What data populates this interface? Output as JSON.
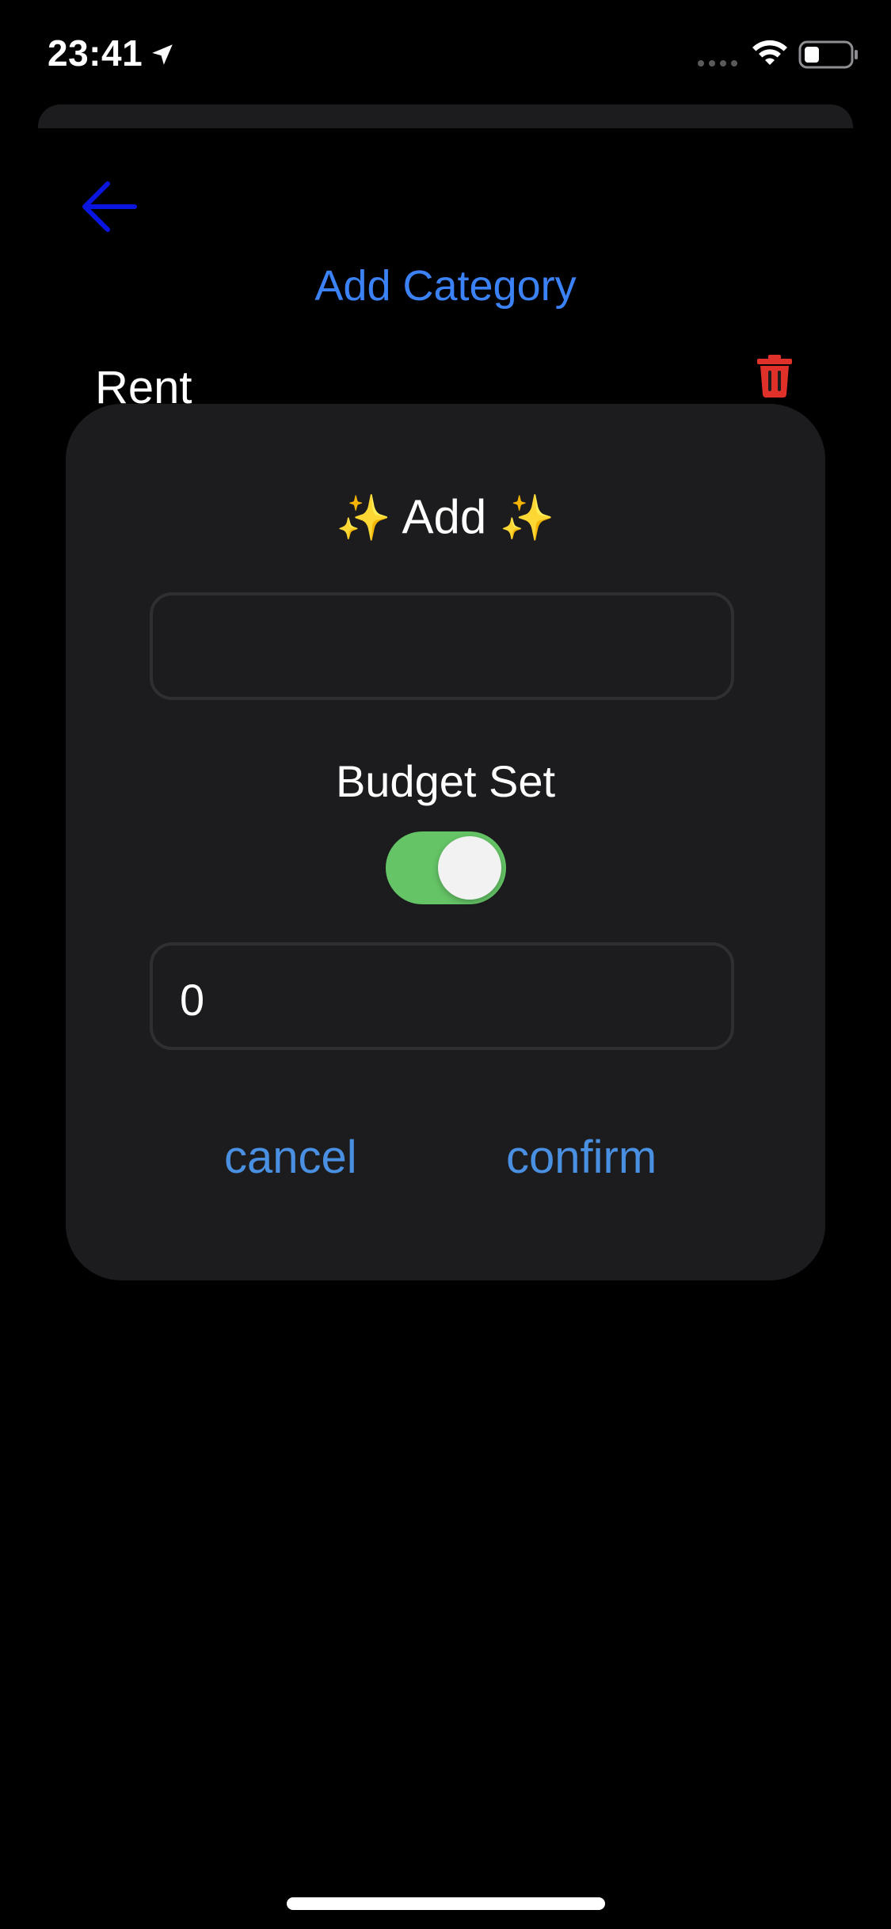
{
  "status_bar": {
    "time": "23:41",
    "location_icon": "location-arrow-icon",
    "signal_icon": "cellular-signal-icon",
    "wifi_icon": "wifi-icon",
    "battery_icon": "battery-icon"
  },
  "header": {
    "back_icon": "arrow-left-icon",
    "add_category_label": "Add Category"
  },
  "category": {
    "name": "Rent",
    "delete_icon": "trash-icon"
  },
  "modal": {
    "title": "Add",
    "title_decoration": "✨",
    "name_input_value": "",
    "budget_label": "Budget Set",
    "budget_toggle_on": true,
    "amount_value": "0",
    "cancel_label": "cancel",
    "confirm_label": "confirm"
  },
  "colors": {
    "background": "#000000",
    "sheet": "#1c1c1e",
    "accent_blue": "#3b82f6",
    "button_blue": "#4a90e2",
    "back_arrow": "#0a16e0",
    "toggle_green": "#65c466",
    "delete_red": "#e0302a"
  }
}
